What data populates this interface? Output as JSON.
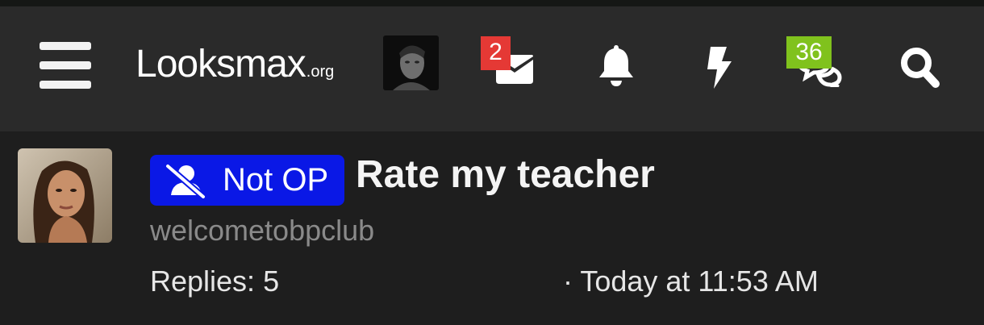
{
  "header": {
    "logo_main": "Looksmax",
    "logo_suffix": ".org",
    "inbox_badge": "2",
    "conversations_badge": "36"
  },
  "thread": {
    "prefix_label": "Not OP",
    "title": "Rate my teacher",
    "author": "welcometobpclub",
    "replies": "Replies: 5",
    "date": "· Today at 11:53 AM"
  },
  "colors": {
    "navbar_bg": "#2a2a2a",
    "page_bg": "#1e1e1e",
    "prefix_bg": "#0a18e6",
    "badge_red": "#e53935",
    "badge_green": "#80c21d"
  },
  "icons": {
    "menu": "hamburger-icon",
    "inbox": "envelope-icon",
    "alerts": "bell-icon",
    "whats_new": "bolt-icon",
    "conversations": "chat-bubbles-icon",
    "search": "search-icon",
    "prefix": "user-slash-icon"
  }
}
